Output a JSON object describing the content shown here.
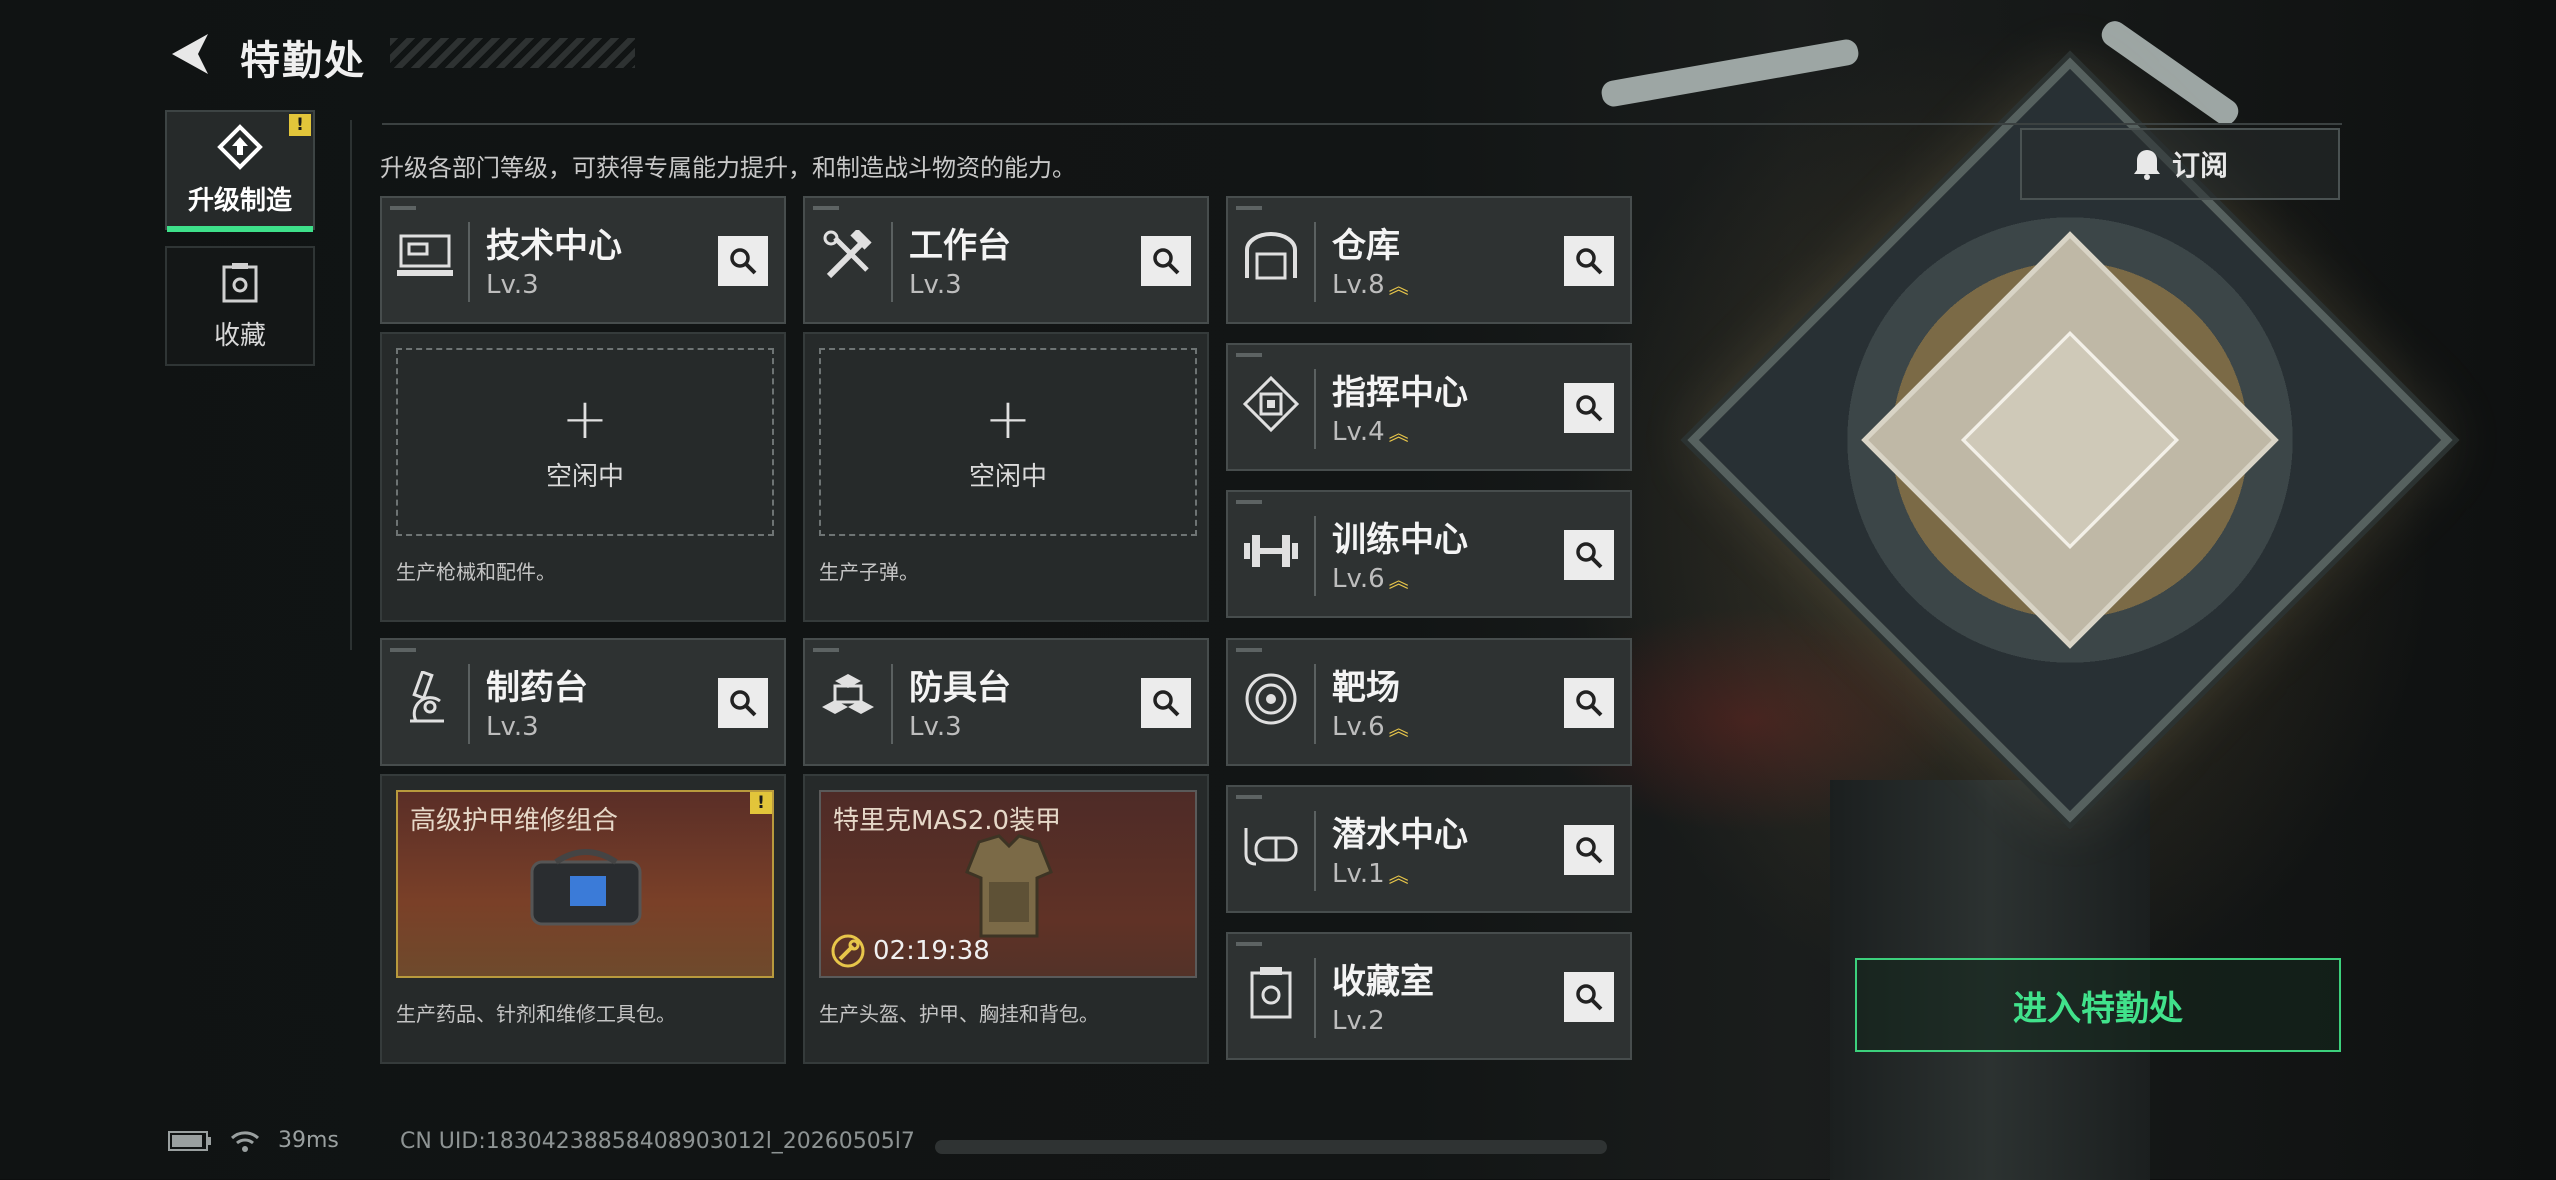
{
  "header": {
    "title": "特勤处"
  },
  "sidebar": {
    "tabs": [
      {
        "label": "升级制造",
        "active": true
      },
      {
        "label": "收藏",
        "active": false
      }
    ],
    "warn_mark": "!"
  },
  "description": "升级各部门等级，可获得专属能力提升，和制造战斗物资的能力。",
  "departments": [
    {
      "name": "技术中心",
      "level": "Lv.3",
      "icon": "tech-terminal-icon",
      "upgradable": false
    },
    {
      "name": "工作台",
      "level": "Lv.3",
      "icon": "tools-icon",
      "upgradable": false
    },
    {
      "name": "仓库",
      "level": "Lv.8",
      "icon": "warehouse-icon",
      "upgradable": true
    },
    {
      "name": "指挥中心",
      "level": "Lv.4",
      "icon": "command-chip-icon",
      "upgradable": true
    },
    {
      "name": "训练中心",
      "level": "Lv.6",
      "icon": "dumbbell-icon",
      "upgradable": true
    },
    {
      "name": "制药台",
      "level": "Lv.3",
      "icon": "microscope-icon",
      "upgradable": false
    },
    {
      "name": "防具台",
      "level": "Lv.3",
      "icon": "armor-blocks-icon",
      "upgradable": false
    },
    {
      "name": "靶场",
      "level": "Lv.6",
      "icon": "target-icon",
      "upgradable": true
    },
    {
      "name": "潜水中心",
      "level": "Lv.1",
      "icon": "diving-mask-icon",
      "upgradable": true
    },
    {
      "name": "收藏室",
      "level": "Lv.2",
      "icon": "collection-icon",
      "upgradable": false
    }
  ],
  "upgrade_mark": "︽",
  "production": {
    "tech": {
      "status": "空闲中",
      "plus": "+",
      "desc": "生产枪械和配件。"
    },
    "workbench": {
      "status": "空闲中",
      "plus": "+",
      "desc": "生产子弹。"
    },
    "pharmacy": {
      "item": "高级护甲维修组合",
      "desc": "生产药品、针剂和维修工具包。"
    },
    "armor": {
      "item": "特里克MAS2.0装甲",
      "timer": "02:19:38",
      "desc": "生产头盔、护甲、胸挂和背包。"
    }
  },
  "buttons": {
    "subscribe": "订阅",
    "enter": "进入特勤处"
  },
  "status_bar": {
    "ping": "39ms",
    "uid": "CN UID:18304238858408903012l_20260505l7"
  },
  "colors": {
    "accent": "#3ee08a",
    "warning": "#e2c53a",
    "upgrade": "#e8c64a"
  }
}
